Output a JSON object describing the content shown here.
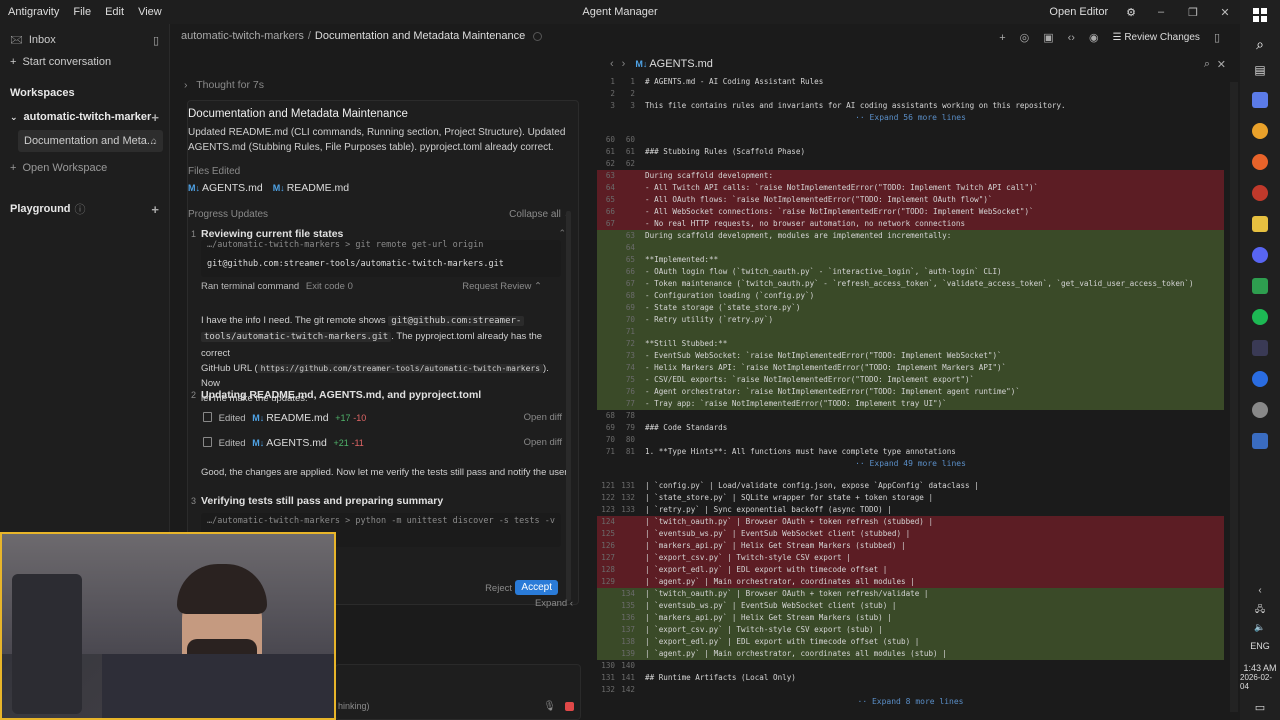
{
  "titlebar": {
    "app_name": "Antigravity",
    "menu": [
      "File",
      "Edit",
      "View"
    ],
    "center_title": "Agent Manager",
    "open_editor": "Open Editor"
  },
  "sidebar": {
    "inbox": "Inbox",
    "start_conversation": "Start conversation",
    "workspaces_heading": "Workspaces",
    "workspace_name": "automatic-twitch-marker",
    "workspace_item": "Documentation and Meta...",
    "open_workspace": "Open Workspace",
    "playground": "Playground"
  },
  "chat": {
    "breadcrumb_root": "automatic-twitch-markers",
    "breadcrumb_current": "Documentation and Metadata Maintenance",
    "thought": "Thought for 7s",
    "task_title": "Documentation and Metadata Maintenance",
    "task_summary_1": "Updated README.md (CLI commands, Running section, Project Structure). Updated",
    "task_summary_2": "AGENTS.md (Stubbing Rules, File Purposes table). pyproject.toml already correct.",
    "files_edited_label": "Files Edited",
    "files": [
      "AGENTS.md",
      "README.md"
    ],
    "progress_label": "Progress Updates",
    "collapse_all": "Collapse all",
    "step1_title": "Reviewing current file states",
    "cmd1_prompt": "…/automatic-twitch-markers > git remote get-url origin",
    "cmd1_output": "git@github.com:streamer-tools/automatic-twitch-markers.git",
    "ran_terminal": "Ran terminal command",
    "exit_code": "Exit code 0",
    "request_review": "Request Review",
    "msg1_a": "I have the info I need. The git remote shows",
    "msg1_code1a": "git@github.com:streamer-",
    "msg1_code1b": "tools/automatic-twitch-markers.git",
    "msg1_b": ". The pyproject.toml already has the correct",
    "msg1_c": "GitHub URL (",
    "msg1_code2": "https://github.com/streamer-tools/automatic-twitch-markers",
    "msg1_d": "). Now",
    "msg1_e": "let me make the updates:",
    "step2_title": "Updating README.md, AGENTS.md, and pyproject.toml",
    "edited": "Edited",
    "edit1_file": "README.md",
    "edit1_add": "+17",
    "edit1_del": "-10",
    "edit2_file": "AGENTS.md",
    "edit2_add": "+21",
    "edit2_del": "-11",
    "open_diff": "Open diff",
    "msg2": "Good, the changes are applied. Now let me verify the tests still pass and notify the user:",
    "step3_title": "Verifying tests still pass and preparing summary",
    "cmd3_prompt": "…/automatic-twitch-markers > python -m unittest discover -s tests -v",
    "reject": "Reject",
    "accept": "Accept",
    "expand": "Expand",
    "thinking": "hinking)"
  },
  "editor": {
    "filename": "AGENTS.md",
    "review_changes": "Review Changes",
    "lines": [
      {
        "o": "1",
        "n": "1",
        "t": "# AGENTS.md - AI Coding Assistant Rules",
        "k": ""
      },
      {
        "o": "2",
        "n": "2",
        "t": "",
        "k": ""
      },
      {
        "o": "3",
        "n": "3",
        "t": "This file contains rules and invariants for AI coding assistants working on this repository.",
        "k": ""
      },
      {
        "exp": "·· Expand 56 more lines"
      },
      {
        "o": "60",
        "n": "60",
        "t": "",
        "k": ""
      },
      {
        "o": "61",
        "n": "61",
        "t": "### Stubbing Rules (Scaffold Phase)",
        "k": ""
      },
      {
        "o": "62",
        "n": "62",
        "t": "",
        "k": ""
      },
      {
        "o": "63",
        "n": "",
        "t": "During scaffold development:",
        "k": "del"
      },
      {
        "o": "64",
        "n": "",
        "t": "- All Twitch API calls: `raise NotImplementedError(\"TODO: Implement Twitch API call\")`",
        "k": "del"
      },
      {
        "o": "65",
        "n": "",
        "t": "- All OAuth flows: `raise NotImplementedError(\"TODO: Implement OAuth flow\")`",
        "k": "del"
      },
      {
        "o": "66",
        "n": "",
        "t": "- All WebSocket connections: `raise NotImplementedError(\"TODO: Implement WebSocket\")`",
        "k": "del"
      },
      {
        "o": "67",
        "n": "",
        "t": "- No real HTTP requests, no browser automation, no network connections",
        "k": "del"
      },
      {
        "o": "",
        "n": "63",
        "t": "During scaffold development, modules are implemented incrementally:",
        "k": "add"
      },
      {
        "o": "",
        "n": "64",
        "t": "",
        "k": "add"
      },
      {
        "o": "",
        "n": "65",
        "t": "**Implemented:**",
        "k": "add"
      },
      {
        "o": "",
        "n": "66",
        "t": "- OAuth login flow (`twitch_oauth.py` - `interactive_login`, `auth-login` CLI)",
        "k": "add"
      },
      {
        "o": "",
        "n": "67",
        "t": "- Token maintenance (`twitch_oauth.py` - `refresh_access_token`, `validate_access_token`, `get_valid_user_access_token`)",
        "k": "add"
      },
      {
        "o": "",
        "n": "68",
        "t": "- Configuration loading (`config.py`)",
        "k": "add"
      },
      {
        "o": "",
        "n": "69",
        "t": "- State storage (`state_store.py`)",
        "k": "add"
      },
      {
        "o": "",
        "n": "70",
        "t": "- Retry utility (`retry.py`)",
        "k": "add"
      },
      {
        "o": "",
        "n": "71",
        "t": "",
        "k": "add"
      },
      {
        "o": "",
        "n": "72",
        "t": "**Still Stubbed:**",
        "k": "add"
      },
      {
        "o": "",
        "n": "73",
        "t": "- EventSub WebSocket: `raise NotImplementedError(\"TODO: Implement WebSocket\")`",
        "k": "add"
      },
      {
        "o": "",
        "n": "74",
        "t": "- Helix Markers API: `raise NotImplementedError(\"TODO: Implement Markers API\")`",
        "k": "add"
      },
      {
        "o": "",
        "n": "75",
        "t": "- CSV/EDL exports: `raise NotImplementedError(\"TODO: Implement export\")`",
        "k": "add"
      },
      {
        "o": "",
        "n": "76",
        "t": "- Agent orchestrator: `raise NotImplementedError(\"TODO: Implement agent runtime\")`",
        "k": "add"
      },
      {
        "o": "",
        "n": "77",
        "t": "- Tray app: `raise NotImplementedError(\"TODO: Implement tray UI\")`",
        "k": "add"
      },
      {
        "o": "68",
        "n": "78",
        "t": "",
        "k": ""
      },
      {
        "o": "69",
        "n": "79",
        "t": "### Code Standards",
        "k": ""
      },
      {
        "o": "70",
        "n": "80",
        "t": "",
        "k": ""
      },
      {
        "o": "71",
        "n": "81",
        "t": "1. **Type Hints**: All functions must have complete type annotations",
        "k": ""
      },
      {
        "exp": "·· Expand 49 more lines"
      },
      {
        "o": "121",
        "n": "131",
        "t": "| `config.py` | Load/validate config.json, expose `AppConfig` dataclass |",
        "k": ""
      },
      {
        "o": "122",
        "n": "132",
        "t": "| `state_store.py` | SQLite wrapper for state + token storage |",
        "k": ""
      },
      {
        "o": "123",
        "n": "133",
        "t": "| `retry.py` | Sync exponential backoff (async TODO) |",
        "k": ""
      },
      {
        "o": "124",
        "n": "",
        "t": "| `twitch_oauth.py` | Browser OAuth + token refresh (stubbed) |",
        "k": "del"
      },
      {
        "o": "125",
        "n": "",
        "t": "| `eventsub_ws.py` | EventSub WebSocket client (stubbed) |",
        "k": "del"
      },
      {
        "o": "126",
        "n": "",
        "t": "| `markers_api.py` | Helix Get Stream Markers (stubbed) |",
        "k": "del"
      },
      {
        "o": "127",
        "n": "",
        "t": "| `export_csv.py` | Twitch-style CSV export |",
        "k": "del"
      },
      {
        "o": "128",
        "n": "",
        "t": "| `export_edl.py` | EDL export with timecode offset |",
        "k": "del"
      },
      {
        "o": "129",
        "n": "",
        "t": "| `agent.py` | Main orchestrator, coordinates all modules |",
        "k": "del"
      },
      {
        "o": "",
        "n": "134",
        "t": "| `twitch_oauth.py` | Browser OAuth + token refresh/validate |",
        "k": "add"
      },
      {
        "o": "",
        "n": "135",
        "t": "| `eventsub_ws.py` | EventSub WebSocket client (stub) |",
        "k": "add"
      },
      {
        "o": "",
        "n": "136",
        "t": "| `markers_api.py` | Helix Get Stream Markers (stub) |",
        "k": "add"
      },
      {
        "o": "",
        "n": "137",
        "t": "| `export_csv.py` | Twitch-style CSV export (stub) |",
        "k": "add"
      },
      {
        "o": "",
        "n": "138",
        "t": "| `export_edl.py` | EDL export with timecode offset (stub) |",
        "k": "add"
      },
      {
        "o": "",
        "n": "139",
        "t": "| `agent.py` | Main orchestrator, coordinates all modules (stub) |",
        "k": "add"
      },
      {
        "o": "130",
        "n": "140",
        "t": "",
        "k": ""
      },
      {
        "o": "131",
        "n": "141",
        "t": "## Runtime Artifacts (Local Only)",
        "k": ""
      },
      {
        "o": "132",
        "n": "142",
        "t": "",
        "k": ""
      },
      {
        "exp": "·· Expand 8 more lines"
      }
    ]
  },
  "tray": {
    "lang": "ENG",
    "time": "1:43 AM",
    "date": "2026-02-04"
  },
  "colors": {
    "accent": "#2a7bd8",
    "diff_del": "#5c1d24",
    "diff_add": "#3a4a28",
    "webcam_border": "#e8b52a"
  }
}
